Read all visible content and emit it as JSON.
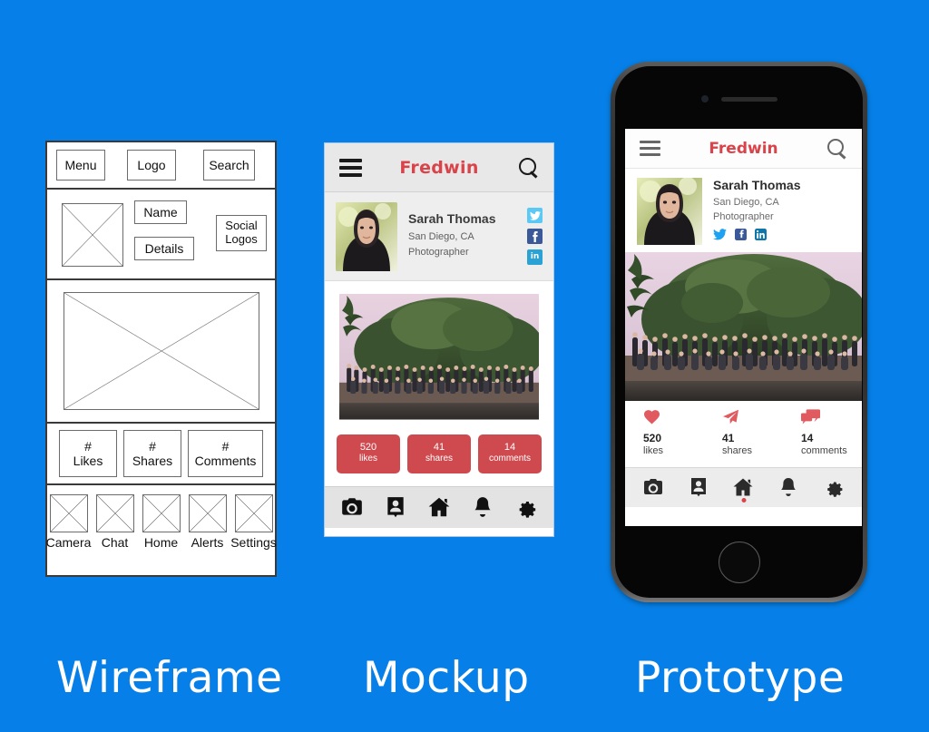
{
  "background_color": "#0680e8",
  "brand_red": "#d9434a",
  "captions": {
    "wireframe": "Wireframe",
    "mockup": "Mockup",
    "prototype": "Prototype"
  },
  "wireframe": {
    "header": {
      "menu": "Menu",
      "logo": "Logo",
      "search": "Search"
    },
    "profile": {
      "avatar_placeholder": "image-placeholder",
      "name": "Name",
      "details": "Details",
      "social": "Social\nLogos",
      "social_line1": "Social",
      "social_line2": "Logos"
    },
    "hero_placeholder": "image-placeholder",
    "stats": [
      {
        "line1": "#",
        "line2": "Likes"
      },
      {
        "line1": "#",
        "line2": "Shares"
      },
      {
        "line1": "#",
        "line2": "Comments"
      }
    ],
    "nav": [
      {
        "label": "Camera"
      },
      {
        "label": "Chat"
      },
      {
        "label": "Home"
      },
      {
        "label": "Alerts"
      },
      {
        "label": "Settings"
      }
    ]
  },
  "mockup": {
    "topbar": {
      "menu_icon": "hamburger-icon",
      "brand": "Fredwin",
      "search_icon": "search-icon"
    },
    "profile": {
      "name": "Sarah Thomas",
      "location": "San Diego, CA",
      "occupation": "Photographer",
      "socials": [
        {
          "name": "twitter",
          "glyph": "✉",
          "color": "#5bc8f5"
        },
        {
          "name": "facebook",
          "glyph": "f",
          "color": "#3b5998"
        },
        {
          "name": "linkedin",
          "glyph": "in",
          "color": "#2aa3d4"
        }
      ]
    },
    "post_image_alt": "group-photo",
    "stats": [
      {
        "num": "520",
        "label": "likes"
      },
      {
        "num": "41",
        "label": "shares"
      },
      {
        "num": "14",
        "label": "comments"
      }
    ],
    "nav": [
      {
        "name": "camera-icon"
      },
      {
        "name": "contact-icon"
      },
      {
        "name": "home-icon"
      },
      {
        "name": "bell-icon"
      },
      {
        "name": "gear-icon"
      }
    ]
  },
  "prototype": {
    "topbar": {
      "menu_icon": "hamburger-icon",
      "brand": "Fredwin",
      "search_icon": "search-icon"
    },
    "profile": {
      "name": "Sarah Thomas",
      "location": "San Diego, CA",
      "occupation": "Photographer",
      "socials": [
        {
          "name": "twitter"
        },
        {
          "name": "facebook"
        },
        {
          "name": "linkedin"
        }
      ]
    },
    "post_image_alt": "group-photo",
    "stats": [
      {
        "icon": "heart-icon",
        "num": "520",
        "label": "likes"
      },
      {
        "icon": "paper-plane-icon",
        "num": "41",
        "label": "shares"
      },
      {
        "icon": "comments-icon",
        "num": "14",
        "label": "comments"
      }
    ],
    "nav": [
      {
        "name": "camera-icon"
      },
      {
        "name": "contact-icon"
      },
      {
        "name": "home-icon"
      },
      {
        "name": "bell-icon"
      },
      {
        "name": "gear-icon"
      }
    ]
  }
}
